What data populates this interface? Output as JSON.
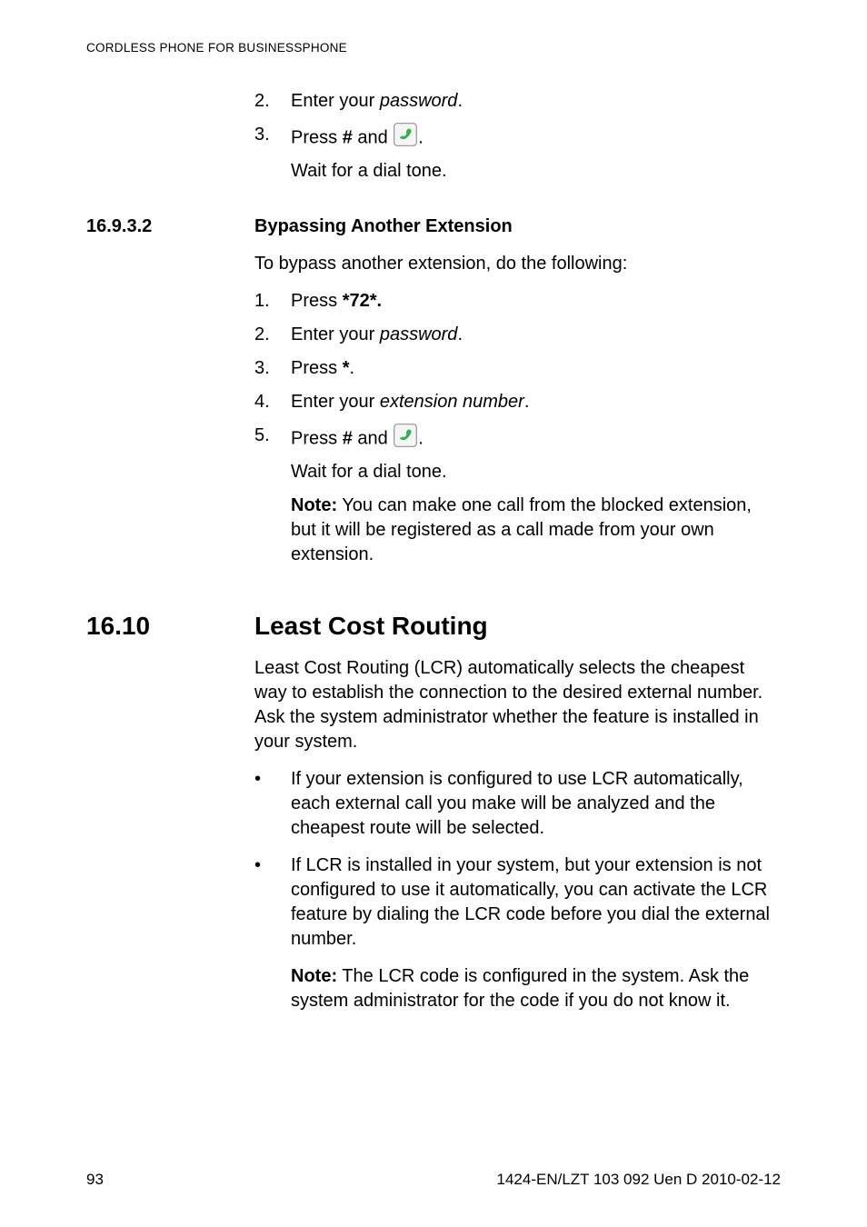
{
  "header": {
    "running": "CORDLESS PHONE FOR BUSINESSPHONE"
  },
  "top_steps": {
    "items": [
      {
        "num": "2.",
        "prefix": "Enter your ",
        "em": "password",
        "suffix": "."
      },
      {
        "num": "3.",
        "prefix": "Press ",
        "bold": "#",
        "mid": " and ",
        "has_icon": true,
        "suffix": ".",
        "sub": "Wait for a dial tone."
      }
    ]
  },
  "section_a": {
    "num": "16.9.3.2",
    "title": "Bypassing Another Extension",
    "intro": "To bypass another extension, do the following:",
    "items": [
      {
        "num": "1.",
        "prefix": "Press ",
        "bold": "*72*."
      },
      {
        "num": "2.",
        "prefix": "Enter your ",
        "em": "password",
        "suffix": "."
      },
      {
        "num": "3.",
        "prefix": "Press ",
        "bold": "*",
        "suffix": "."
      },
      {
        "num": "4.",
        "prefix": "Enter your ",
        "em": "extension number",
        "suffix": "."
      },
      {
        "num": "5.",
        "prefix": "Press ",
        "bold": "#",
        "mid": " and ",
        "has_icon": true,
        "suffix": ".",
        "sub": "Wait for a dial tone."
      }
    ],
    "note_label": "Note:",
    "note_text": "  You can make one call from the blocked extension, but it will be registered as a call made from your own extension."
  },
  "section_b": {
    "num": "16.10",
    "title": "Least Cost Routing",
    "intro": "Least Cost Routing (LCR) automatically selects the cheapest way to establish the connection to the desired external number. Ask the system administrator whether the feature is installed in your system.",
    "bullets": [
      "If your extension is configured to use LCR automatically, each external call you make will be analyzed and the cheapest route will be selected.",
      "If LCR is installed in your system, but your extension is not configured to use it automatically, you can activate the LCR feature by dialing the LCR code before you dial the external number."
    ],
    "note_label": "Note:",
    "note_text": "  The LCR code is configured in the system. Ask the system administrator for the code if you do not know it."
  },
  "footer": {
    "left": "93",
    "right": "1424-EN/LZT 103 092 Uen D 2010-02-12"
  }
}
